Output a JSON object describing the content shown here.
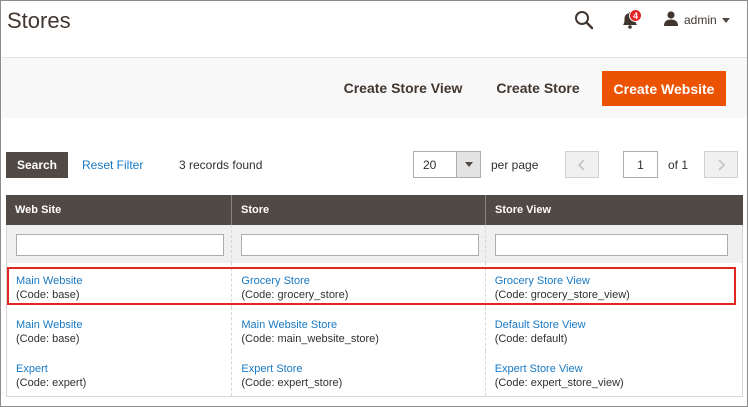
{
  "header": {
    "title": "Stores",
    "notification_count": "4",
    "user_name": "admin"
  },
  "actions": {
    "create_store_view": "Create Store View",
    "create_store": "Create Store",
    "create_website": "Create Website"
  },
  "toolbar": {
    "search_label": "Search",
    "reset_filter_label": "Reset Filter",
    "records_found": "3 records found",
    "per_page_value": "20",
    "per_page_label": "per page",
    "current_page": "1",
    "of_pages": "of 1"
  },
  "grid": {
    "columns": [
      "Web Site",
      "Store",
      "Store View"
    ],
    "rows": [
      {
        "website": "Main Website",
        "website_code": "(Code: base)",
        "store": "Grocery Store",
        "store_code": "(Code: grocery_store)",
        "view": "Grocery Store View",
        "view_code": "(Code: grocery_store_view)"
      },
      {
        "website": "Main Website",
        "website_code": "(Code: base)",
        "store": "Main Website Store",
        "store_code": "(Code: main_website_store)",
        "view": "Default Store View",
        "view_code": "(Code: default)"
      },
      {
        "website": "Expert",
        "website_code": "(Code: expert)",
        "store": "Expert Store",
        "store_code": "(Code: expert_store)",
        "view": "Expert Store View",
        "view_code": "(Code: expert_store_view)"
      }
    ]
  },
  "colors": {
    "accent": "#eb5202",
    "header_dark": "#514943",
    "link": "#1979c3",
    "highlight": "#e0281e"
  }
}
